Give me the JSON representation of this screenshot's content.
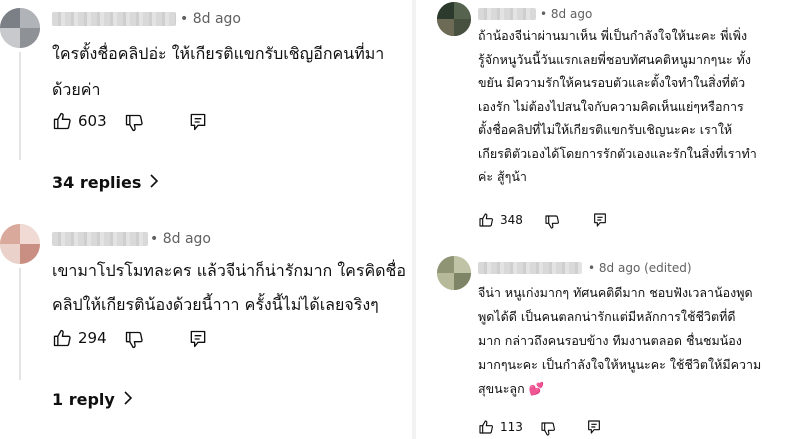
{
  "comments": [
    {
      "time": "8d ago",
      "text": "ใครตั้งชื่อคลิปอ่ะ ให้เกียรติแขกรับเชิญอีกคนที่มา\nด้วยค่า",
      "likes": "603",
      "replies_label": "34 replies"
    },
    {
      "time": "8d ago",
      "text": "เขามาโปรโมทละคร แล้วจีน่าก็น่ารักมาก ใครคิดชื่อ\nคลิปให้เกียรติน้องด้วยนี้าาา ครั้งนี้ไม่ได้เลยจริงๆ",
      "likes": "294",
      "replies_label": "1 reply"
    },
    {
      "time": "8d ago",
      "text": "ถ้าน้องจีน่าผ่านมาเห็น พี่เป็นกำลังใจให้นะคะ พี่เพิ่ง\nรู้จักหนูวันนี้วันแรกเลยพี่ชอบทัศนคติหนูมากๆนะ ทั้ง\nขยัน มีความรักให้คนรอบตัวและตั้งใจทำในสิ่งที่ตัว\nเองรัก ไม่ต้องไปสนใจกับความคิดเห็นแย่ๆหรือการ\nตั้งชื่อคลิปที่ไม่ให้เกียรติแขกรับเชิญนะคะ เราให้\nเกียรติตัวเองได้โดยการรักตัวเองและรักในสิ่งที่เราทำ\nค่ะ สู้ๆน้า",
      "likes": "348"
    },
    {
      "time": "8d ago (edited)",
      "text": "จีน่า หนูเก่งมากๆ ทัศนคติดีมาก ชอบฟังเวลาน้องพูด\nพูดได้ดี เป็นคนตลกน่ารักแต่มีหลักการใช้ชีวิตที่ดี\nมาก กล่าวถึงคนรอบข้าง ทีมงานตลอด ชื่นชมน้อง\nมากๆนะคะ เป็นกำลังใจให้หนูนะคะ ใช้ชีวิตให้มีความ\nสุขนะลูก 💕",
      "likes": "113"
    }
  ],
  "icons": {
    "like": "thumbs-up-icon",
    "dislike": "thumbs-down-icon",
    "reply": "reply-icon",
    "expand": "chevron-right-icon"
  },
  "colors": {
    "meta": "#606060",
    "text": "#0f0f0f",
    "thread": "#e5e5e5"
  }
}
